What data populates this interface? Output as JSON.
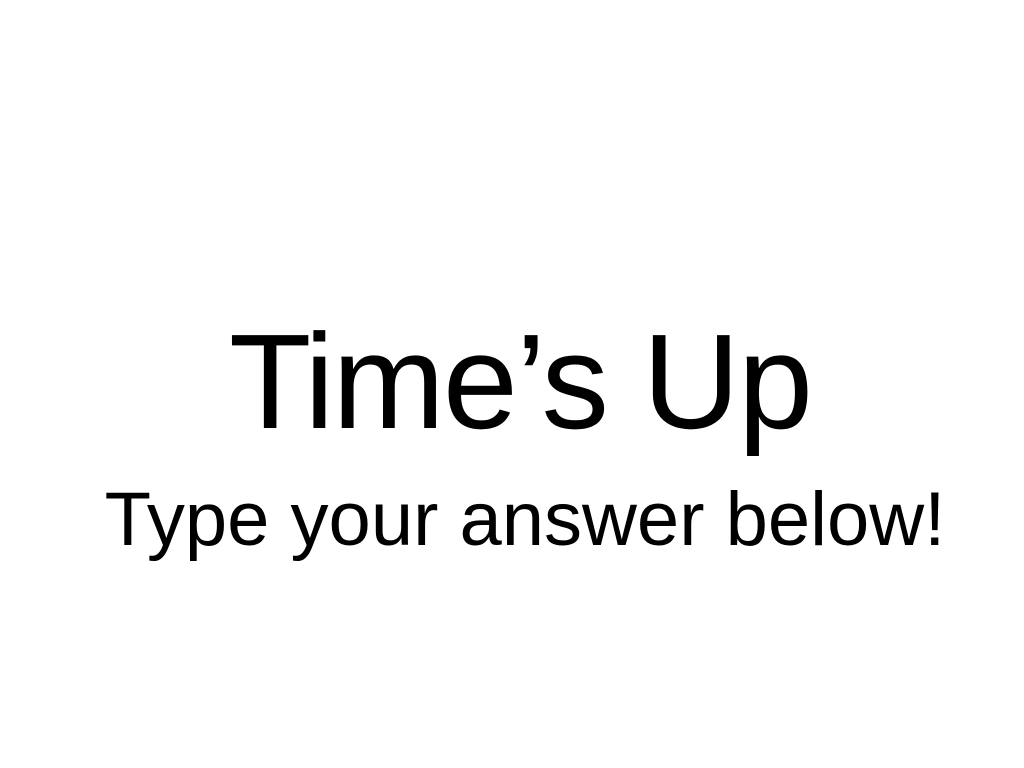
{
  "screen": {
    "title": "Time’s Up",
    "subtitle": "Type your answer below!"
  },
  "colors": {
    "background": "#ffffff",
    "text": "#000000"
  }
}
